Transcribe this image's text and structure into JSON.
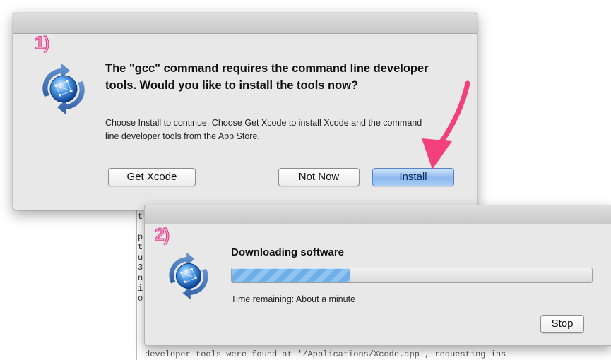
{
  "dialog1": {
    "step_label": "1)",
    "heading": "The \"gcc\" command requires the command line developer tools. Would you like to install the tools now?",
    "body": "Choose Install to continue. Choose Get Xcode to install Xcode and the command line developer tools from the App Store.",
    "buttons": {
      "get_xcode": "Get Xcode",
      "not_now": "Not Now",
      "install": "Install"
    }
  },
  "dialog2": {
    "step_label": "2)",
    "title": "Downloading software",
    "progress_fraction": 0.33,
    "time_remaining": "Time remaining: About a minute",
    "buttons": {
      "stop": "Stop"
    }
  },
  "terminal": {
    "left_column": [
      "t",
      "p",
      "t",
      "u",
      "3",
      "n",
      "i",
      "o"
    ],
    "bottom_line": "developer tools were found at '/Applications/Xcode.app', requesting ins"
  },
  "colors": {
    "annotation_arrow": "#f2407d",
    "step_label": "#ff9bc7",
    "progress_fill": "#7ab8ea",
    "install_button": "#8cb9ee"
  },
  "icons": [
    "software-update-globe-icon",
    "annotation-arrow-icon"
  ]
}
